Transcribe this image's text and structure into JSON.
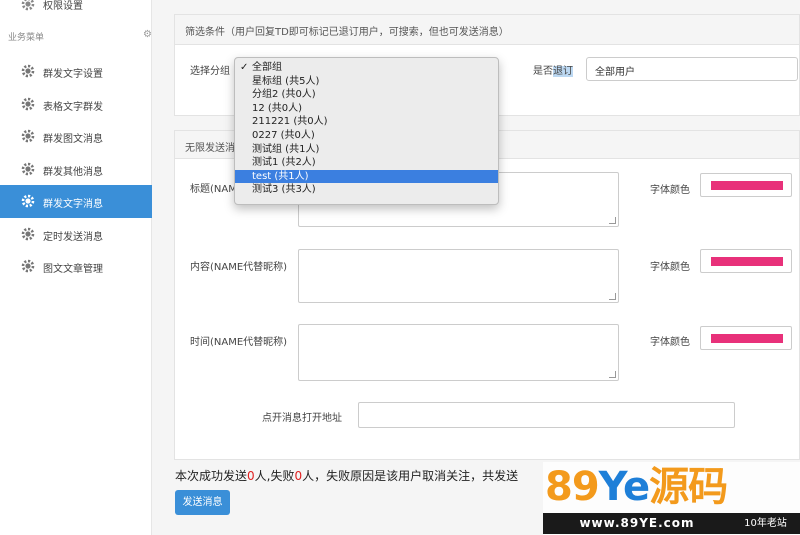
{
  "sidebar": {
    "top_item": "权限设置",
    "section_label": "业务菜单",
    "items": [
      {
        "label": "群发文字设置"
      },
      {
        "label": "表格文字群发"
      },
      {
        "label": "群发图文消息"
      },
      {
        "label": "群发其他消息"
      },
      {
        "label": "群发文字消息"
      },
      {
        "label": "定时发送消息"
      },
      {
        "label": "图文文章管理"
      }
    ],
    "active_index": 4
  },
  "filter": {
    "header": "筛选条件（用户回复TD即可标记已退订用户，可搜索，但也可发送消息）",
    "group_label": "选择分组",
    "unsub_label_prefix": "是否",
    "unsub_label_highlight": "退订",
    "unsub_value": "全部用户"
  },
  "dropdown": {
    "options": [
      {
        "label": "全部组",
        "checked": true
      },
      {
        "label": "星标组 (共5人)"
      },
      {
        "label": "分组2 (共0人)"
      },
      {
        "label": "12 (共0人)"
      },
      {
        "label": "211221 (共0人)"
      },
      {
        "label": "0227 (共0人)"
      },
      {
        "label": "测试组 (共1人)"
      },
      {
        "label": "测试1 (共2人)"
      },
      {
        "label": "test (共1人)",
        "highlighted": true
      },
      {
        "label": "测试3 (共3人)"
      }
    ]
  },
  "message": {
    "header": "无限发送消",
    "title_label": "标题(NAME",
    "content_label": "内容(NAME代替昵称)",
    "time_label": "时间(NAME代替昵称)",
    "color_label": "字体颜色",
    "font_color": "#e8317a",
    "url_label": "点开消息打开地址",
    "url_value": ""
  },
  "result": {
    "part1": "本次成功发送",
    "success_count": "0",
    "part2": "人,失败",
    "fail_count": "0",
    "part3": "人，失败原因是该用户取消关注，共发送"
  },
  "send_button": "发送消息",
  "watermark": {
    "logo_num": "89",
    "logo_ye": "Ye",
    "logo_cn": "源码",
    "url": "www.89YE.com",
    "tag": "10年老站"
  }
}
